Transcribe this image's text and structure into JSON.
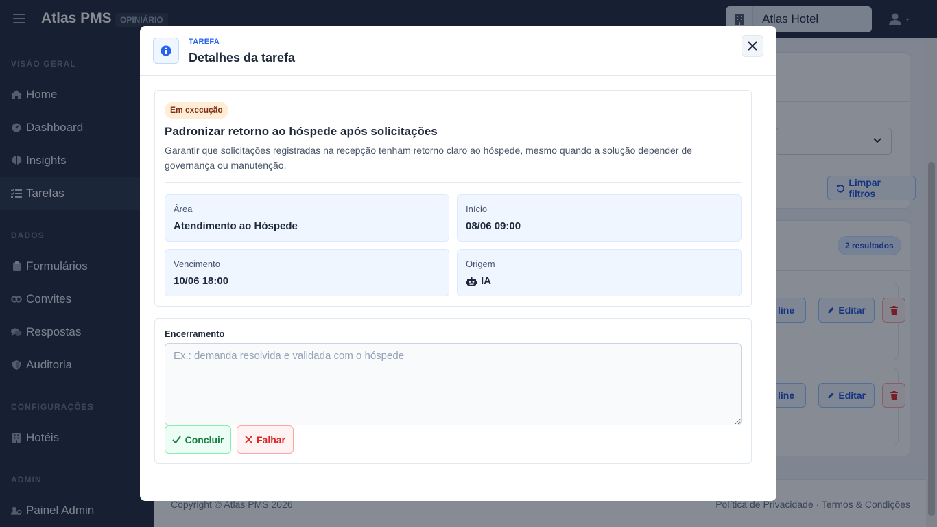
{
  "topbar": {
    "brand": "Atlas PMS",
    "brand_tag": "OPINIÁRIO",
    "hotel_name": "Atlas Hotel"
  },
  "sidebar": {
    "sections": [
      {
        "title": "VISÃO GERAL",
        "items": [
          {
            "label": "Home",
            "icon": "home-icon"
          },
          {
            "label": "Dashboard",
            "icon": "gauge-icon"
          },
          {
            "label": "Insights",
            "icon": "brain-icon"
          },
          {
            "label": "Tarefas",
            "icon": "task-list-icon",
            "active": true
          }
        ]
      },
      {
        "title": "DADOS",
        "items": [
          {
            "label": "Formulários",
            "icon": "clipboard-icon"
          },
          {
            "label": "Convites",
            "icon": "link-icon"
          },
          {
            "label": "Respostas",
            "icon": "comments-icon"
          },
          {
            "label": "Auditoria",
            "icon": "shield-icon"
          }
        ]
      },
      {
        "title": "CONFIGURAÇÕES",
        "items": [
          {
            "label": "Hotéis",
            "icon": "building-icon"
          }
        ]
      },
      {
        "title": "ADMIN",
        "items": [
          {
            "label": "Painel Admin",
            "icon": "user-cog-icon"
          }
        ]
      }
    ]
  },
  "background": {
    "clear_filters": "Limpar filtros",
    "results_badge": "2 resultados",
    "row_partial_label": "line",
    "edit_label": "Editar"
  },
  "footer": {
    "copyright": "Copyright © Atlas PMS 2026",
    "links": "Política de Privacidade · Termos & Condições"
  },
  "modal": {
    "kicker": "TAREFA",
    "title": "Detalhes da tarefa",
    "status": "Em execução",
    "task_title": "Padronizar retorno ao hóspede após solicitações",
    "task_desc": "Garantir que solicitações registradas na recepção tenham retorno claro ao hóspede, mesmo quando a solução depender de governança ou manutenção.",
    "fields": {
      "area": {
        "label": "Área",
        "value": "Atendimento ao Hóspede"
      },
      "start": {
        "label": "Início",
        "value": "08/06 09:00"
      },
      "due": {
        "label": "Vencimento",
        "value": "10/06 18:00"
      },
      "origin": {
        "label": "Origem",
        "value": "IA",
        "icon": "robot-icon"
      }
    },
    "closure": {
      "label": "Encerramento",
      "value": "",
      "placeholder": "Ex.: demanda resolvida e validada com o hóspede",
      "conclude": "Concluir",
      "fail": "Falhar"
    }
  },
  "colors": {
    "primary": "#2563eb",
    "sidebar_bg": "#1e293b",
    "success": "#15803d",
    "danger": "#dc2626",
    "status_bg": "#ffedd5"
  }
}
